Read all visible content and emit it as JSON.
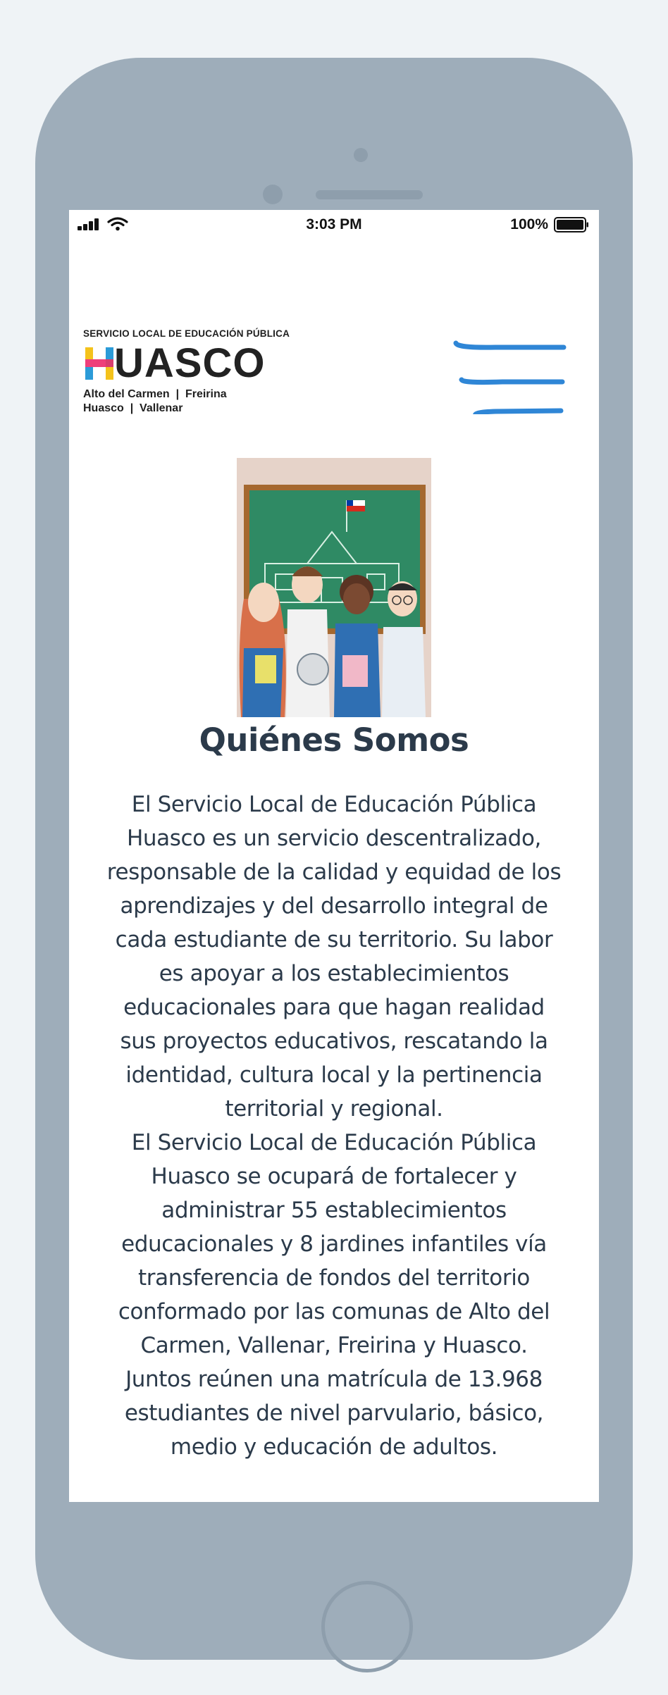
{
  "status_bar": {
    "time": "3:03 PM",
    "battery": "100%"
  },
  "logo": {
    "top_line": "SERVICIO LOCAL DE EDUCACIÓN PÚBLICA",
    "wordmark_h": "H",
    "wordmark_rest": "UASCO",
    "sub_line_1": "Alto del Carmen  |  Freirina",
    "sub_line_2": "Huasco  |  Vallenar"
  },
  "icons": {
    "menu": "hamburger-menu-icon",
    "signal": "cellular-signal-icon",
    "wifi": "wifi-icon",
    "battery": "battery-icon"
  },
  "colors": {
    "menu_stroke": "#2f86d6",
    "title_text": "#2b3a4a",
    "device_frame": "#9eadba"
  },
  "main": {
    "title": "Quiénes Somos",
    "paragraph_1": "El Servicio Local de Educación Pública Huasco es un servicio descentralizado, responsable de la calidad y equidad de los aprendizajes y del desarrollo integral de cada estudiante de su territorio. Su labor es apoyar a los establecimientos educacionales para que hagan realidad sus proyectos educativos, rescatando la identidad, cultura local y la pertinencia territorial y regional.",
    "paragraph_2": "El Servicio Local de Educación Pública Huasco se ocupará de fortalecer y administrar 55 establecimientos educacionales y 8 jardines infantiles vía transferencia de fondos del territorio conformado por las comunas de Alto del Carmen, Vallenar, Freirina y Huasco. Juntos reúnen una matrícula de 13.968 estudiantes de nivel parvulario, básico, medio y educación de adultos."
  }
}
